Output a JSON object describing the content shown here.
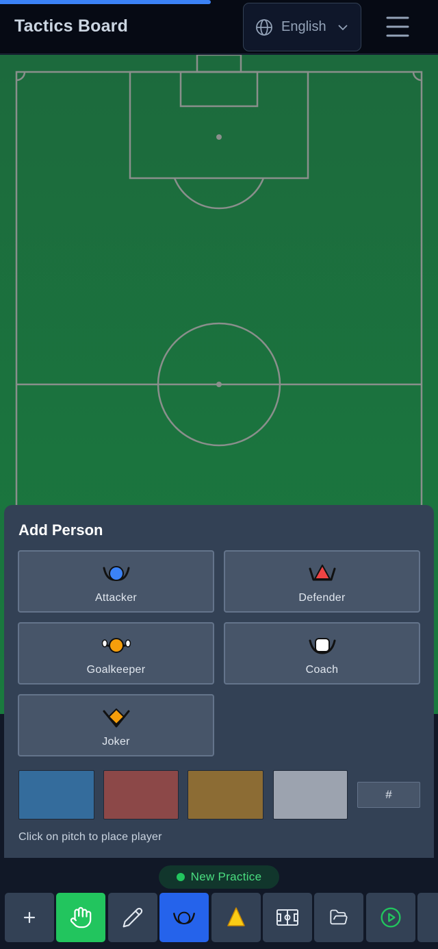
{
  "header": {
    "title": "Tactics Board",
    "language": "English",
    "globe_icon": "globe-icon",
    "chevron_icon": "chevron-down-icon",
    "menu_icon": "hamburger-menu-icon"
  },
  "panel": {
    "title": "Add Person",
    "roles": [
      {
        "label": "Attacker",
        "icon": "attacker-icon",
        "color": "#3b82f6"
      },
      {
        "label": "Defender",
        "icon": "defender-icon",
        "color": "#ef4444"
      },
      {
        "label": "Goalkeeper",
        "icon": "goalkeeper-icon",
        "color": "#f59e0b"
      },
      {
        "label": "Coach",
        "icon": "coach-icon",
        "color": "#ffffff"
      },
      {
        "label": "Joker",
        "icon": "joker-icon",
        "color": "#f59e0b"
      }
    ],
    "swatches": [
      "#346c9c",
      "#8c4848",
      "#8c6c34",
      "#9ca3af"
    ],
    "hex_placeholder": "#",
    "hint": "Click on pitch to place player"
  },
  "toolbar": {
    "session_label": "New Practice",
    "session_status_color": "#22c55e",
    "tools": [
      {
        "name": "add",
        "icon": "plus-icon"
      },
      {
        "name": "move",
        "icon": "hand-icon",
        "active_color": "#22c55e"
      },
      {
        "name": "draw",
        "icon": "pencil-icon"
      },
      {
        "name": "person",
        "icon": "person-icon",
        "active_color": "#2563eb"
      },
      {
        "name": "cone",
        "icon": "cone-icon"
      },
      {
        "name": "pitch",
        "icon": "pitch-icon"
      },
      {
        "name": "open",
        "icon": "folder-icon"
      },
      {
        "name": "play",
        "icon": "play-icon"
      }
    ]
  },
  "colors": {
    "pitch": "#1b743e",
    "panel": "#334155",
    "accent_blue": "#2563eb",
    "accent_green": "#22c55e"
  }
}
